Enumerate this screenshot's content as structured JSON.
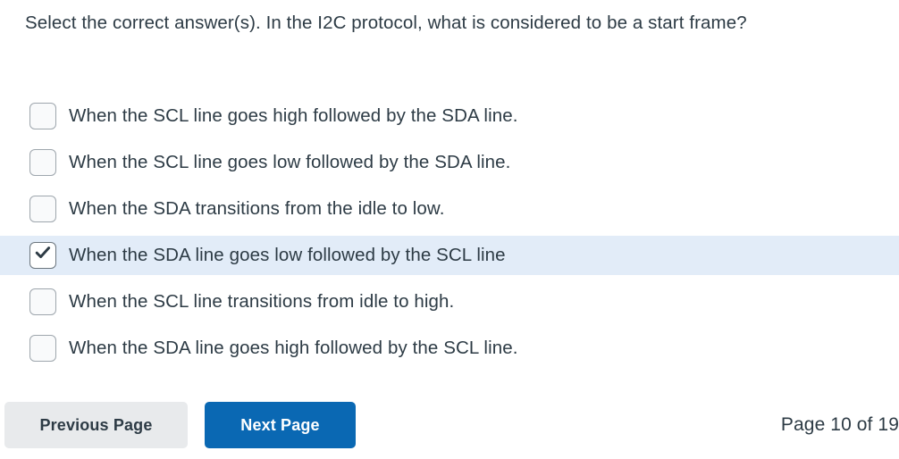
{
  "question": {
    "prompt": "Select the correct answer(s). In the I2C protocol, what is considered to be a start frame?",
    "options": [
      {
        "label": "When the SCL line goes high followed by the SDA line.",
        "checked": false
      },
      {
        "label": "When the SCL line goes low followed by the SDA line.",
        "checked": false
      },
      {
        "label": "When the SDA transitions from the idle to low.",
        "checked": false
      },
      {
        "label": "When the SDA line goes low followed by the SCL line",
        "checked": true
      },
      {
        "label": "When the SCL line transitions from idle to high.",
        "checked": false
      },
      {
        "label": "When the SDA line goes high followed by the SCL line.",
        "checked": false
      }
    ]
  },
  "footer": {
    "previous_label": "Previous Page",
    "next_label": "Next Page",
    "page_indicator": "Page 10 of 19"
  },
  "colors": {
    "text": "#2d3b45",
    "selected_row_background": "#e2ecf8",
    "next_button_background": "#0a68b3",
    "previous_button_background": "#e8eaec",
    "checkbox_border": "#9ea6ad",
    "checkmark": "#2d3b45"
  }
}
